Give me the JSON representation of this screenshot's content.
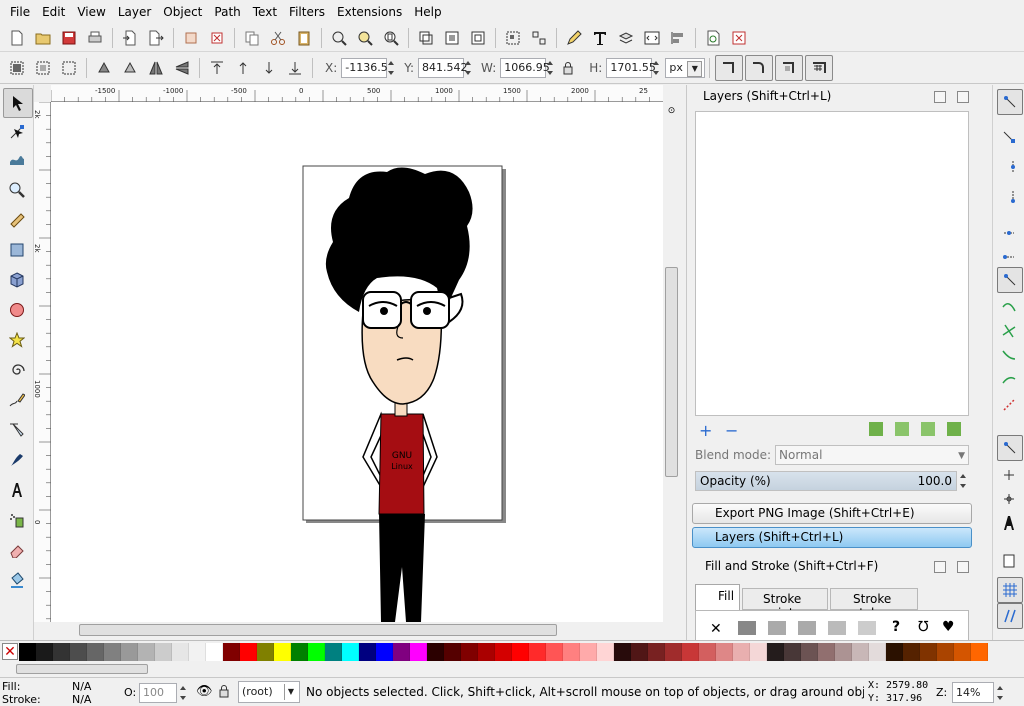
{
  "menu": [
    "File",
    "Edit",
    "View",
    "Layer",
    "Object",
    "Path",
    "Text",
    "Filters",
    "Extensions",
    "Help"
  ],
  "toolcontrols": {
    "x_label": "X:",
    "x_value": "-1136.5",
    "y_label": "Y:",
    "y_value": "841.542",
    "w_label": "W:",
    "w_value": "1066.95",
    "h_label": "H:",
    "h_value": "1701.55",
    "unit": "px"
  },
  "ruler": {
    "h_labels": [
      "-1500",
      "-1000",
      "-500",
      "0",
      "500",
      "1000",
      "1500",
      "2000",
      "25"
    ],
    "v_labels": [
      "2k",
      "2k",
      "1000",
      "0"
    ]
  },
  "canvas": {
    "shirt_line1": "GNU",
    "shirt_line2": "Linux",
    "colors": {
      "skin": "#f8dcc1",
      "hair": "#000000",
      "shirt": "#a50d12",
      "pants": "#000000"
    }
  },
  "layers_panel": {
    "title": "Layers (Shift+Ctrl+L)",
    "blend_label": "Blend mode:",
    "blend_value": "Normal",
    "opacity_label": "Opacity (%)",
    "opacity_value": "100.0"
  },
  "expanders": {
    "export": "Export PNG Image (Shift+Ctrl+E)",
    "layers": "Layers (Shift+Ctrl+L)"
  },
  "fill_stroke": {
    "title": "Fill and Stroke (Shift+Ctrl+F)",
    "tabs": [
      "Fill",
      "Stroke paint",
      "Stroke style"
    ]
  },
  "palette": [
    "#000000",
    "#1a1a1a",
    "#333333",
    "#4d4d4d",
    "#666666",
    "#808080",
    "#999999",
    "#b3b3b3",
    "#cccccc",
    "#e6e6e6",
    "#f2f2f2",
    "#ffffff",
    "#800000",
    "#ff0000",
    "#808000",
    "#ffff00",
    "#008000",
    "#00ff00",
    "#008080",
    "#00ffff",
    "#000080",
    "#0000ff",
    "#800080",
    "#ff00ff",
    "#2b0000",
    "#550000",
    "#800000",
    "#aa0000",
    "#d40000",
    "#ff0000",
    "#ff2a2a",
    "#ff5555",
    "#ff8080",
    "#ffaaaa",
    "#ffd5d5",
    "#280b0b",
    "#501616",
    "#782121",
    "#a02c2c",
    "#c83737",
    "#d35f5f",
    "#de8787",
    "#e9afaf",
    "#f4d7d7",
    "#241c1c",
    "#483737",
    "#6c5353",
    "#916f6f",
    "#ac9393",
    "#c8b7b7",
    "#e3dbdb",
    "#2b1100",
    "#552200",
    "#803300",
    "#aa4400",
    "#d45500",
    "#ff6600"
  ],
  "status": {
    "fill_label": "Fill:",
    "fill_value": "N/A",
    "stroke_label": "Stroke:",
    "stroke_value": "N/A",
    "opacity_label": "O:",
    "opacity_value": "100",
    "layer_value": "(root)",
    "message": "No objects selected. Click, Shift+click, Alt+scroll mouse on top of objects, or drag around objects to select.",
    "x_coord": "X: 2579.80",
    "y_coord": "Y:  317.96",
    "zoom_label": "Z:",
    "zoom_value": "14%"
  }
}
